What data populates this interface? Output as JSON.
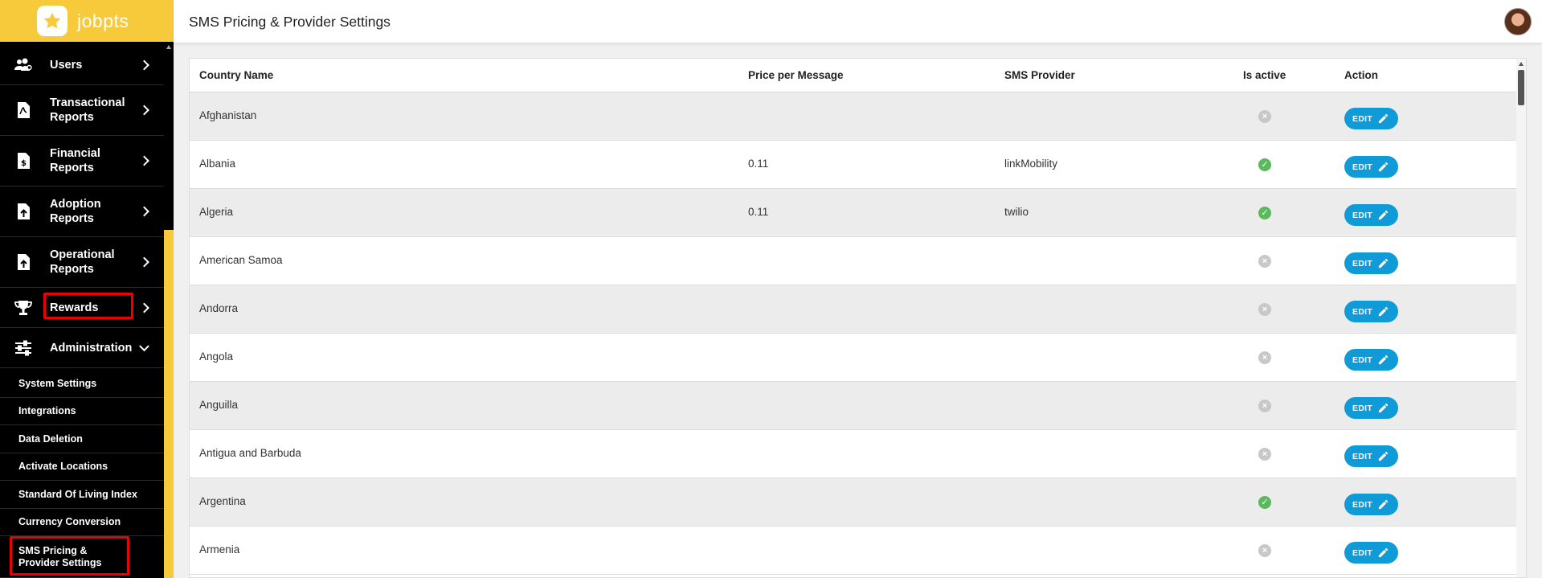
{
  "brand": {
    "name": "jobpts"
  },
  "header": {
    "title": "SMS Pricing & Provider Settings"
  },
  "sidebar": {
    "items": [
      {
        "label": "Users",
        "icon": "users-icon"
      },
      {
        "label": "Transactional Reports",
        "icon": "transactional-report-icon"
      },
      {
        "label": "Financial Reports",
        "icon": "financial-report-icon"
      },
      {
        "label": "Adoption Reports",
        "icon": "adoption-report-icon"
      },
      {
        "label": "Operational Reports",
        "icon": "operational-report-icon"
      },
      {
        "label": "Rewards",
        "icon": "trophy-icon"
      },
      {
        "label": "Administration",
        "icon": "sliders-icon"
      }
    ],
    "subitems": [
      "System Settings",
      "Integrations",
      "Data Deletion",
      "Activate Locations",
      "Standard Of Living Index",
      "Currency Conversion",
      "SMS Pricing & Provider Settings"
    ]
  },
  "table": {
    "columns": [
      "Country Name",
      "Price per Message",
      "SMS Provider",
      "Is active",
      "Action"
    ],
    "edit_label": "EDIT",
    "rows": [
      {
        "country": "Afghanistan",
        "price": "",
        "provider": "",
        "active": false
      },
      {
        "country": "Albania",
        "price": "0.11",
        "provider": "linkMobility",
        "active": true
      },
      {
        "country": "Algeria",
        "price": "0.11",
        "provider": "twilio",
        "active": true
      },
      {
        "country": "American Samoa",
        "price": "",
        "provider": "",
        "active": false
      },
      {
        "country": "Andorra",
        "price": "",
        "provider": "",
        "active": false
      },
      {
        "country": "Angola",
        "price": "",
        "provider": "",
        "active": false
      },
      {
        "country": "Anguilla",
        "price": "",
        "provider": "",
        "active": false
      },
      {
        "country": "Antigua and Barbuda",
        "price": "",
        "provider": "",
        "active": false
      },
      {
        "country": "Argentina",
        "price": "",
        "provider": "",
        "active": true
      },
      {
        "country": "Armenia",
        "price": "",
        "provider": "",
        "active": false
      }
    ]
  },
  "colors": {
    "brand_yellow": "#f6ca3b",
    "sidebar_bg": "#000000",
    "edit_button": "#0f9bd8",
    "active_green": "#5cb85c",
    "inactive_gray": "#c8c8c8",
    "highlight_red": "#e00000"
  }
}
